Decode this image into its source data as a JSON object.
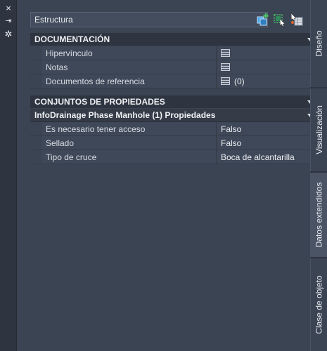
{
  "strip": {
    "close_icon": "×",
    "pin_icon": "⇥",
    "settings_icon": "✲"
  },
  "combo": {
    "selected": "Estructura"
  },
  "sections": [
    {
      "title": "DOCUMENTACIÓN",
      "rows": [
        {
          "label": "Hipervínculo",
          "value": ""
        },
        {
          "label": "Notas",
          "value": ""
        },
        {
          "label": "Documentos de referencia",
          "value": "(0)"
        }
      ]
    },
    {
      "title": "CONJUNTOS DE PROPIEDADES",
      "subtitle": "InfoDrainage Phase Manhole (1) Propiedades",
      "rows": [
        {
          "label": "Es necesario tener acceso",
          "value": "Falso"
        },
        {
          "label": "Sellado",
          "value": "Falso"
        },
        {
          "label": "Tipo de cruce",
          "value": "Boca de alcantarilla"
        }
      ]
    }
  ],
  "tabs": [
    "Diseño",
    "Visualización",
    "Datos extendidos",
    "Clase de objeto"
  ],
  "colors": {
    "panel_bg": "#3b4453",
    "header_bg": "#2e3440",
    "accent_blue": "#4aa3e6",
    "accent_green": "#4cc26b"
  }
}
